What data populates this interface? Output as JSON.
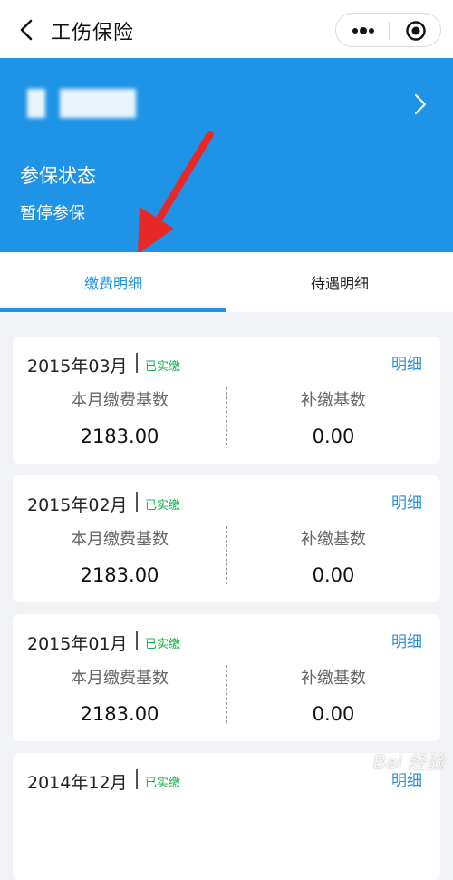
{
  "header": {
    "title": "工伤保险"
  },
  "banner": {
    "status_label": "参保状态",
    "status_value": "暂停参保"
  },
  "tabs": [
    {
      "label": "缴费明细",
      "active": true
    },
    {
      "label": "待遇明细",
      "active": false
    }
  ],
  "records": [
    {
      "date": "2015年03月",
      "paid_label": "已实缴",
      "detail_label": "明细",
      "base_label": "本月缴费基数",
      "base_value": "2183.00",
      "supp_label": "补缴基数",
      "supp_value": "0.00"
    },
    {
      "date": "2015年02月",
      "paid_label": "已实缴",
      "detail_label": "明细",
      "base_label": "本月缴费基数",
      "base_value": "2183.00",
      "supp_label": "补缴基数",
      "supp_value": "0.00"
    },
    {
      "date": "2015年01月",
      "paid_label": "已实缴",
      "detail_label": "明细",
      "base_label": "本月缴费基数",
      "base_value": "2183.00",
      "supp_label": "补缴基数",
      "supp_value": "0.00"
    },
    {
      "date": "2014年12月",
      "paid_label": "已实缴",
      "detail_label": "明细"
    }
  ],
  "watermark": "Bai 经验",
  "colors": {
    "accent": "#1f94e6",
    "paid": "#18b24a",
    "annotation_arrow": "#e62828"
  }
}
